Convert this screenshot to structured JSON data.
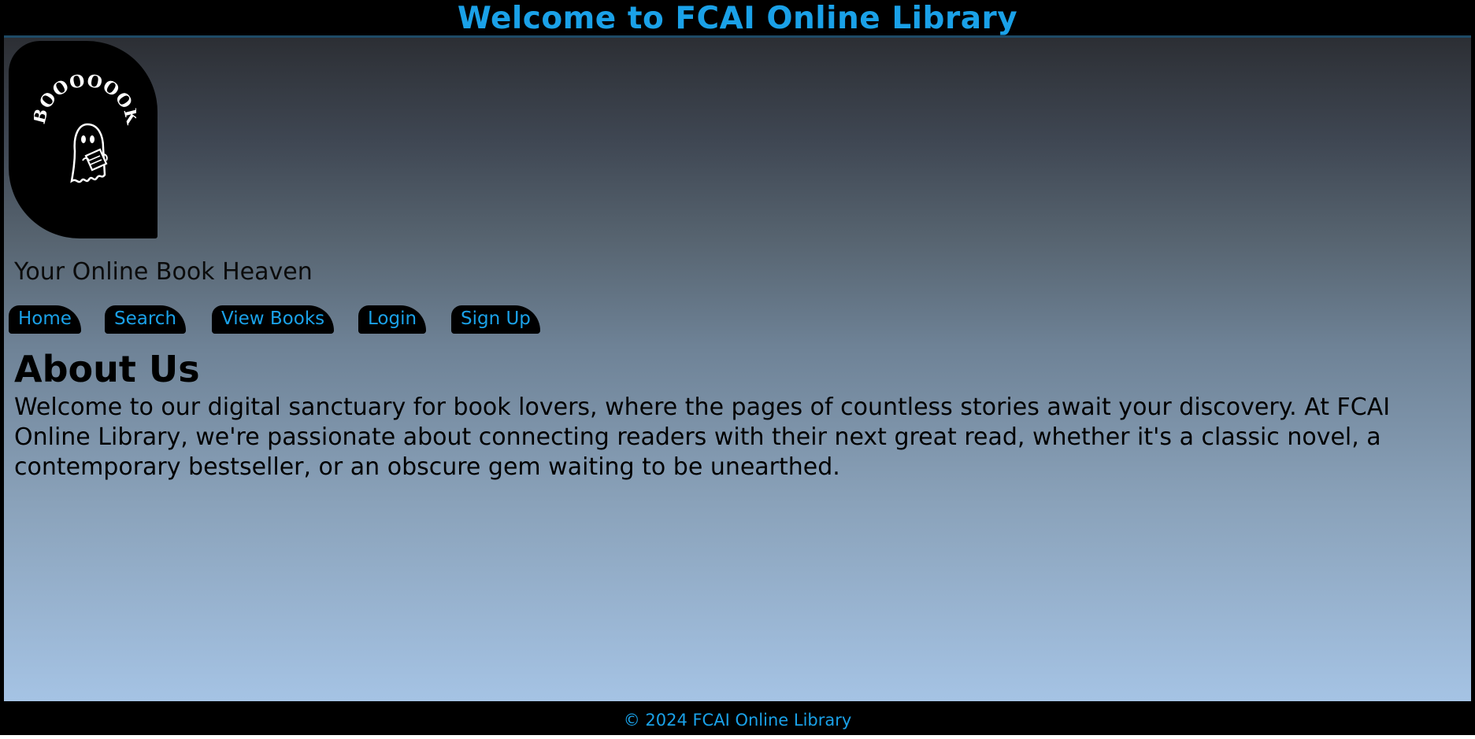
{
  "header": {
    "title": "Welcome to FCAI Online Library"
  },
  "logo": {
    "icon": "ghost-reading-book-icon",
    "text": "BOOOOOOKS"
  },
  "tagline": "Your Online Book Heaven",
  "nav": {
    "items": [
      {
        "label": "Home"
      },
      {
        "label": "Search"
      },
      {
        "label": "View Books"
      },
      {
        "label": "Login"
      },
      {
        "label": "Sign Up"
      }
    ]
  },
  "about": {
    "title": "About Us",
    "text": "Welcome to our digital sanctuary for book lovers, where the pages of countless stories await your discovery. At FCAI Online Library, we're passionate about connecting readers with their next great read, whether it's a classic novel, a contemporary bestseller, or an obscure gem waiting to be unearthed."
  },
  "footer": {
    "text": "© 2024 FCAI Online Library"
  },
  "colors": {
    "accent": "#1aa1e8",
    "bar": "#000000",
    "gradient_top": "#222428",
    "gradient_bottom": "#a5c3e4"
  }
}
